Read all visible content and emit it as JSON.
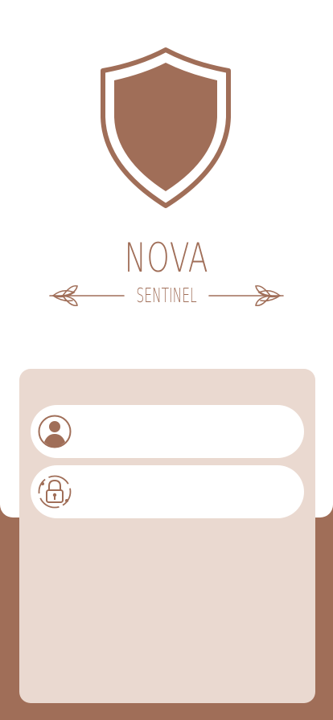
{
  "brand": {
    "title": "NOVA",
    "subtitle": "SENTINEL"
  },
  "login": {
    "username": {
      "value": "",
      "placeholder": ""
    },
    "password": {
      "value": "",
      "placeholder": ""
    }
  },
  "icons": {
    "logo": "shield-icon",
    "left_ornament": "leaf-branch-icon",
    "right_ornament": "leaf-branch-icon",
    "username": "user-avatar-icon",
    "password": "padlock-icon"
  },
  "colors": {
    "brand": "#a06e58",
    "panel": "#ead9d0",
    "card": "#ffffff"
  }
}
